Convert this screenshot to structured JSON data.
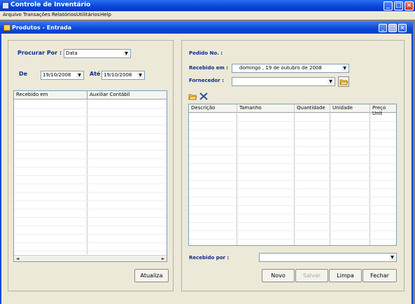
{
  "app": {
    "title": "Controle de Inventário"
  },
  "menu": [
    "Arquivo",
    "Transações",
    "Relatórios",
    "Utilitários",
    "Help"
  ],
  "child_window": {
    "title": "Produtos - Entrada"
  },
  "search": {
    "procurar_label": "Procurar Por :",
    "procurar_value": "Data",
    "de_label": "De",
    "de_value": "19/10/2008",
    "ate_label": "Até",
    "ate_value": "19/10/2008"
  },
  "left_grid": {
    "columns": [
      "Recebido em",
      "Auxiliar Contábil"
    ]
  },
  "atualiza_label": "Atualiza",
  "order": {
    "pedido_label": "Pedido No. :",
    "recebido_em_label": "Recebido em :",
    "recebido_em_value": "domingo   , 19 de  outubro  de 2008",
    "fornecedor_label": "Fornecedor :",
    "fornecedor_value": ""
  },
  "items_grid": {
    "columns": [
      "Descrição",
      "Tamanho",
      "Quantidade",
      "Unidade",
      "Preço Unit"
    ]
  },
  "recebido_por": {
    "label": "Recebido por :",
    "value": ""
  },
  "buttons": {
    "novo": "Novo",
    "salvar": "Salvar",
    "limpa": "Limpa",
    "fechar": "Fechar"
  }
}
